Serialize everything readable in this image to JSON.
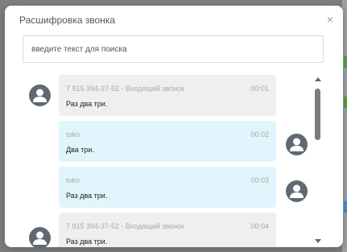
{
  "modal": {
    "title": "Расшифровка звонка",
    "close_glyph": "×"
  },
  "search": {
    "placeholder": "введите текст для поиска"
  },
  "messages": [
    {
      "sender": "7 915 394-37-52 - Входящий звонок",
      "time": "00:01",
      "text": "Раз два три.",
      "direction": "incoming"
    },
    {
      "sender": "toko",
      "time": "00:02",
      "text": "Два три.",
      "direction": "outgoing"
    },
    {
      "sender": "toko",
      "time": "00:03",
      "text": "Раз два три.",
      "direction": "outgoing"
    },
    {
      "sender": "7 915 394-37-52 - Входящий звонок",
      "time": "00:04",
      "text": "Раз два три.",
      "direction": "incoming"
    }
  ],
  "colors": {
    "incoming_bubble": "#efefef",
    "outgoing_bubble": "#e1f5fc",
    "avatar": "#5f6873"
  },
  "icons": {
    "avatar": "user-avatar-icon",
    "close": "close-icon"
  }
}
